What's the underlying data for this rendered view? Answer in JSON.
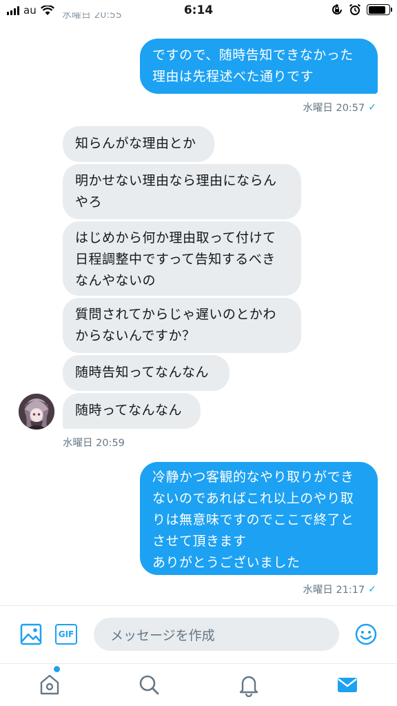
{
  "status_bar": {
    "carrier": "au",
    "time": "6:14",
    "battery_level": 0.85
  },
  "cut_timestamp": "水曜日 20:55",
  "messages": [
    {
      "direction": "sent",
      "lines": [
        "ですので、随時告知できなかった",
        "理由は先程述べた通りです"
      ]
    },
    {
      "direction": "received",
      "lines": [
        "知らんがな理由とか"
      ]
    },
    {
      "direction": "received",
      "lines": [
        "明かせない理由なら理由にならん",
        "やろ"
      ]
    },
    {
      "direction": "received",
      "lines": [
        "はじめから何か理由取って付けて",
        "日程調整中ですって告知するべき",
        "なんやないの"
      ]
    },
    {
      "direction": "received",
      "lines": [
        "質問されてからじゃ遅いのとかわ",
        "からないんですか？"
      ]
    },
    {
      "direction": "received",
      "lines": [
        "随時告知ってなんなん"
      ]
    },
    {
      "direction": "received",
      "lines": [
        "随時ってなんなん"
      ]
    },
    {
      "direction": "sent",
      "lines": [
        "冷静かつ客観的なやり取りができ",
        "ないのであればこれ以上のやり取",
        "りは無意味ですのでここで終了と",
        "させて頂きます",
        "ありがとうございました"
      ]
    }
  ],
  "timestamps": {
    "sent_1": "水曜日 20:57",
    "received_group": "水曜日 20:59",
    "sent_2": "水曜日 21:17"
  },
  "composer": {
    "placeholder": "メッセージを作成",
    "gif_label": "GIF"
  },
  "tabs": [
    "home-icon",
    "search-icon",
    "notifications-icon",
    "messages-icon"
  ],
  "colors": {
    "accent": "#1da1f2",
    "received_bubble": "#e8ecee",
    "timestamp": "#657786"
  }
}
